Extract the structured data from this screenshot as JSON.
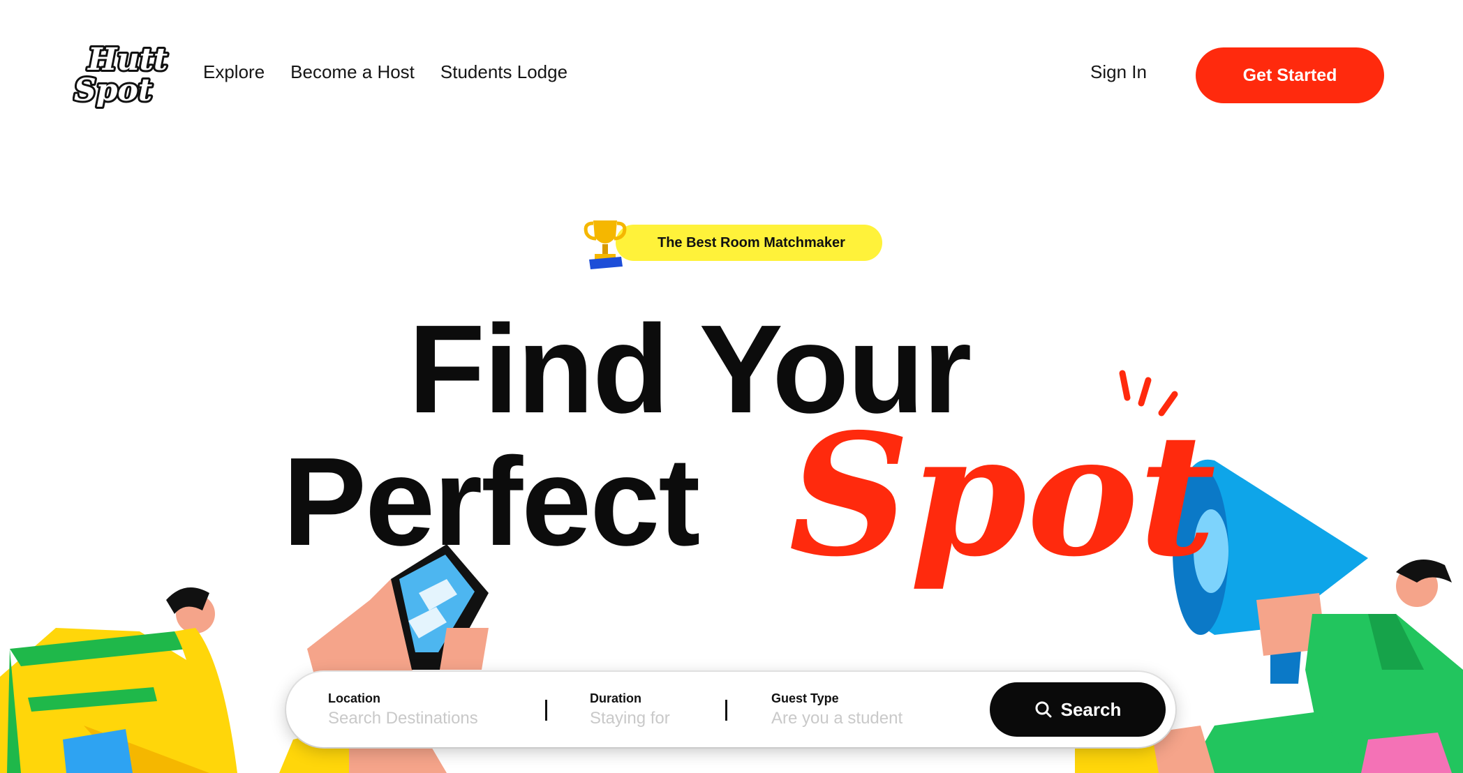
{
  "brand": {
    "logo_line1": "Hutt",
    "logo_line2": "Spot"
  },
  "nav": {
    "items": [
      {
        "label": "Explore"
      },
      {
        "label": "Become a Host"
      },
      {
        "label": "Students Lodge"
      }
    ],
    "sign_in_label": "Sign In",
    "cta_label": "Get Started"
  },
  "hero": {
    "badge_text": "The Best Room Matchmaker",
    "headline_line1": "Find Your",
    "headline_line2": "Perfect",
    "headline_accent": "Spot"
  },
  "search": {
    "fields": [
      {
        "label": "Location",
        "placeholder": "Search Destinations",
        "value": ""
      },
      {
        "label": "Duration",
        "placeholder": "Staying for",
        "value": ""
      },
      {
        "label": "Guest Type",
        "placeholder": "Are you a student",
        "value": ""
      }
    ],
    "button_label": "Search",
    "button_icon": "search-icon"
  },
  "icons": {
    "logo": "hutt-spot-logo",
    "badge": "trophy-icon"
  },
  "colors": {
    "brand_red": "#ff2a0d",
    "badge_yellow": "#fff23a",
    "button_black": "#0a0a0a",
    "megaphone_blue": "#0ea5e9",
    "figure_green": "#22c55e"
  }
}
